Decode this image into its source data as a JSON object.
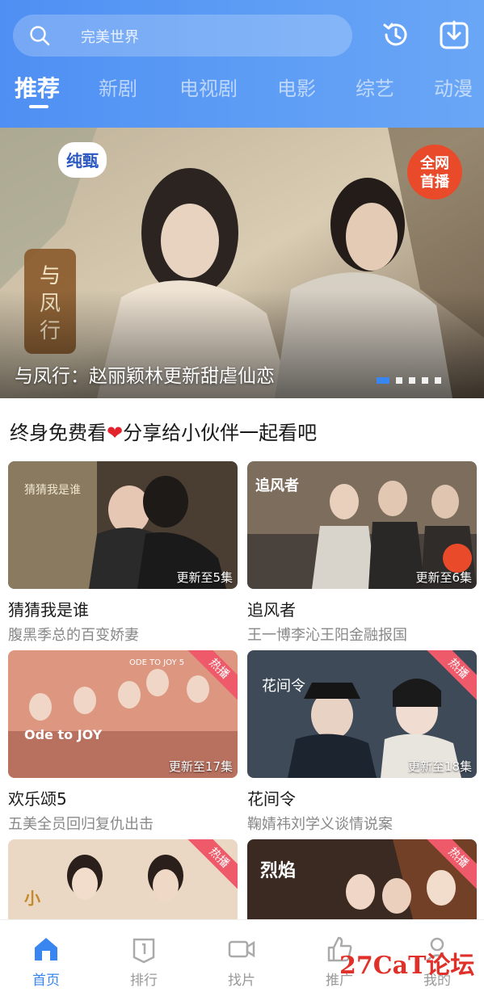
{
  "search": {
    "placeholder": "完美世界",
    "icon": "search-icon"
  },
  "header_actions": [
    {
      "name": "history-icon"
    },
    {
      "name": "download-icon"
    }
  ],
  "tabs": [
    {
      "label": "推荐",
      "active": true
    },
    {
      "label": "新剧"
    },
    {
      "label": "电视剧"
    },
    {
      "label": "电影"
    },
    {
      "label": "综艺"
    },
    {
      "label": "动漫"
    }
  ],
  "banner": {
    "caption": "与凤行：赵丽颖林更新甜虐仙恋",
    "badge": "全网首播",
    "logo": "纯甄",
    "poster_title": "与凤行",
    "slides_total": 5,
    "slide_active": 1
  },
  "section": {
    "title_prefix": "终身免费看",
    "emoji": "❤️",
    "title_suffix": "分享给小伙伴一起看吧"
  },
  "cards": [
    {
      "title": "猜猜我是谁",
      "subtitle": "腹黑季总的百变娇妻",
      "episodes": "更新至5集",
      "hot": false,
      "colors": [
        "#5a4a3a",
        "#2a2320"
      ]
    },
    {
      "title": "追风者",
      "subtitle": "王一博李沁王阳金融报国",
      "episodes": "更新至6集",
      "hot": false,
      "colors": [
        "#8a7a6a",
        "#3a3432"
      ]
    },
    {
      "title": "欢乐颂5",
      "subtitle": "五美全员回归复仇出击",
      "episodes": "更新至17集",
      "hot": true,
      "hot_label": "热播",
      "colors": [
        "#d9907a",
        "#b56a5a"
      ]
    },
    {
      "title": "花间令",
      "subtitle": "鞠婧祎刘学义谈情说案",
      "episodes": "更新至18集",
      "hot": true,
      "hot_label": "热播",
      "colors": [
        "#4a5a6a",
        "#2a2f38"
      ]
    },
    {
      "title": "",
      "subtitle": "",
      "episodes": "",
      "hot": true,
      "hot_label": "热播",
      "colors": [
        "#e9d8c8",
        "#c9b59c"
      ]
    },
    {
      "title": "",
      "subtitle": "",
      "episodes": "",
      "hot": true,
      "hot_label": "热播",
      "colors": [
        "#5a3a2a",
        "#2a1a14"
      ]
    }
  ],
  "bottom_nav": [
    {
      "label": "首页",
      "icon": "home-icon",
      "active": true
    },
    {
      "label": "排行",
      "icon": "ranking-icon"
    },
    {
      "label": "找片",
      "icon": "video-camera-icon"
    },
    {
      "label": "推广",
      "icon": "thumbs-up-icon"
    },
    {
      "label": "我的",
      "icon": "user-icon"
    }
  ],
  "watermark": "27CaT论坛",
  "colors": {
    "accent": "#3a86f0",
    "header_start": "#4f8ff3",
    "hot": "#ef5a6a"
  }
}
